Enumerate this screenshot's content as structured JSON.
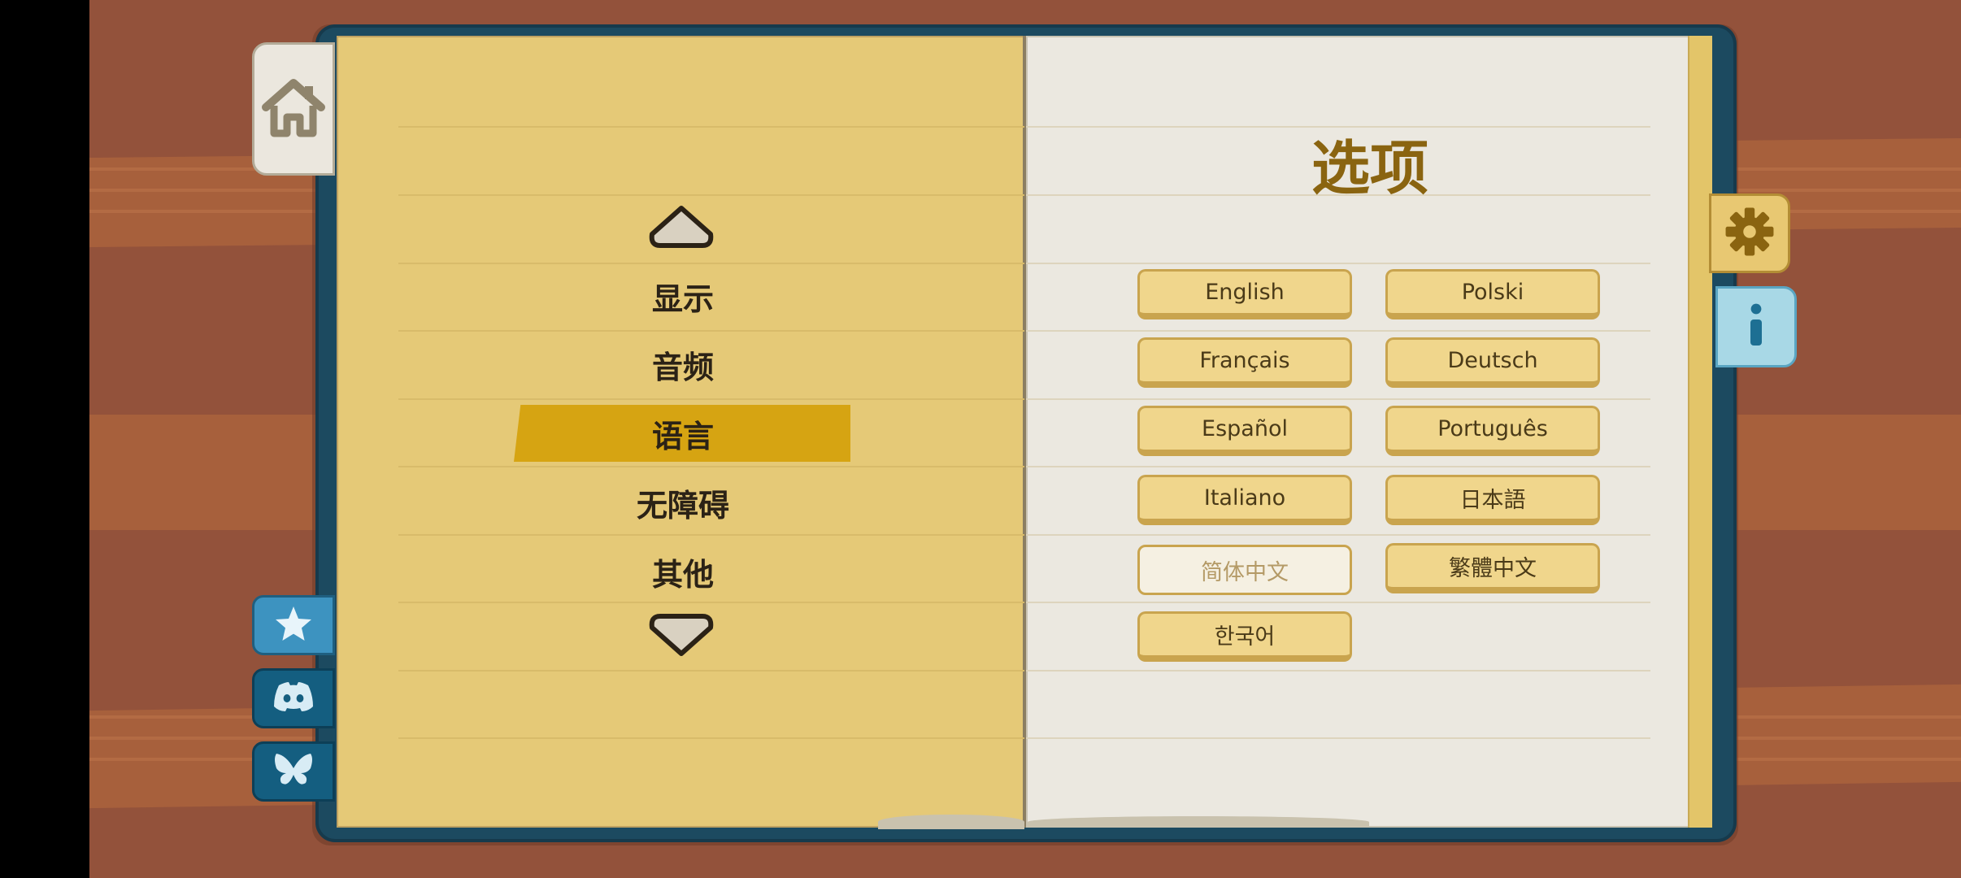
{
  "title": "选项",
  "menu": {
    "items": [
      {
        "label": "显示"
      },
      {
        "label": "音频"
      },
      {
        "label": "语言"
      },
      {
        "label": "无障碍"
      },
      {
        "label": "其他"
      }
    ],
    "selected": "语言"
  },
  "languages": [
    {
      "label": "English"
    },
    {
      "label": "Polski"
    },
    {
      "label": "Français"
    },
    {
      "label": "Deutsch"
    },
    {
      "label": "Español"
    },
    {
      "label": "Português"
    },
    {
      "label": "Italiano"
    },
    {
      "label": "日本語"
    },
    {
      "label": "简体中文"
    },
    {
      "label": "繁體中文"
    },
    {
      "label": "한국어"
    }
  ],
  "selected_language": "简体中文",
  "side_tabs": {
    "left": [
      "home-icon",
      "star-icon",
      "discord-icon",
      "butterfly-icon"
    ],
    "right": [
      "gear-icon",
      "info-icon"
    ]
  },
  "colors": {
    "background": "#93523b",
    "book_cover": "#1c4a60",
    "left_page": "#e5c977",
    "right_page": "#ebe8e0",
    "highlight": "#d6a412",
    "title": "#8a6410"
  }
}
